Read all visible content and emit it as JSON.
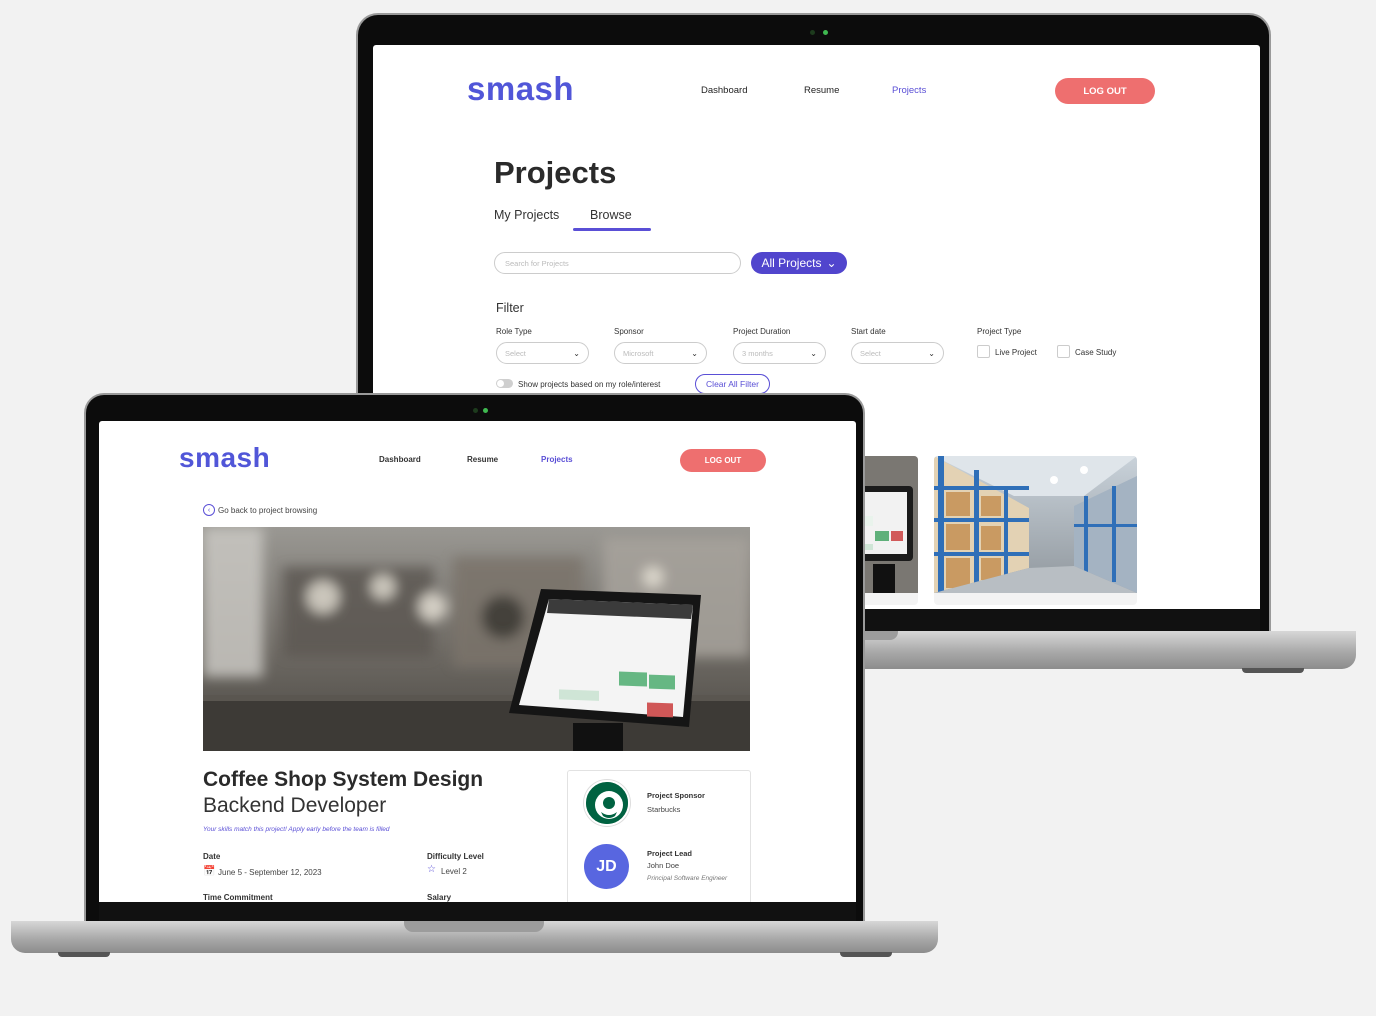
{
  "back_screen": {
    "logo": "smash",
    "nav": [
      "Dashboard",
      "Resume",
      "Projects"
    ],
    "active_nav": "Projects",
    "logout_label": "LOG OUT",
    "page_title": "Projects",
    "tabs": [
      "My Projects",
      "Browse"
    ],
    "active_tab": "Browse",
    "search_placeholder": "Search for Projects",
    "all_projects_label": "All Projects",
    "filter_heading": "Filter",
    "filters": [
      {
        "label": "Role Type",
        "value": "Select"
      },
      {
        "label": "Sponsor",
        "value": "Microsoft"
      },
      {
        "label": "Project Duration",
        "value": "3 months"
      },
      {
        "label": "Start date",
        "value": "Select"
      }
    ],
    "project_type": {
      "label": "Project Type",
      "options": [
        "Live Project",
        "Case Study"
      ]
    },
    "toggle_label": "Show projects based on my role/interest",
    "clear_filter_label": "Clear All Filter"
  },
  "front_screen": {
    "logo": "smash",
    "nav": [
      "Dashboard",
      "Resume",
      "Projects"
    ],
    "active_nav": "Projects",
    "logout_label": "LOG OUT",
    "back_link": "Go back to project browsing",
    "project_title": "Coffee Shop System Design",
    "role": "Backend Developer",
    "match_hint": "Your skills match this project! Apply early before the team is filled",
    "date_label": "Date",
    "date_value": "June 5 - September 12, 2023",
    "difficulty_label": "Difficulty Level",
    "difficulty_value": "Level 2",
    "time_label": "Time Commitment",
    "salary_label": "Salary",
    "sponsor_label": "Project Sponsor",
    "sponsor_value": "Starbucks",
    "sponsor_logo_text": "STARBUCKS COFFEE",
    "lead_label": "Project Lead",
    "lead_name": "John Doe",
    "lead_initials": "JD",
    "lead_role": "Principal Software Engineer"
  },
  "colors": {
    "brand": "#5156d8",
    "accent": "#5a4fd6",
    "logout": "#ee6f6f",
    "starbucks": "#006241"
  },
  "icons": [
    "back-arrow-icon",
    "calendar-icon",
    "star-icon",
    "chevron-down-icon"
  ]
}
